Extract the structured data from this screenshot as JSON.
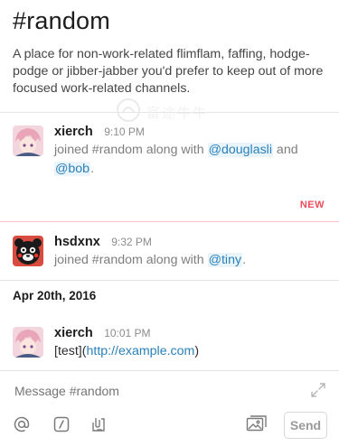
{
  "channel": {
    "title": "#random",
    "description": "A place for non-work-related flimflam, faffing, hodge-podge or jibber-jabber you'd prefer to keep out of more focused work-related channels."
  },
  "watermark": {
    "text": "富途牛牛"
  },
  "messages": [
    {
      "author": "xierch",
      "time": "9:10 PM",
      "text_parts": [
        "joined #random along with ",
        "@douglasli",
        " and ",
        "@bob",
        "."
      ]
    },
    {
      "author": "hsdxnx",
      "time": "9:32 PM",
      "text_parts": [
        "joined #random along with ",
        "@tiny",
        "."
      ]
    },
    {
      "author": "xierch",
      "time": "10:01 PM",
      "text_parts": [
        "[test](",
        "http://example.com",
        ")"
      ]
    }
  ],
  "new_marker": "NEW",
  "date_separator": "Apr 20th, 2016",
  "composer": {
    "placeholder": "Message #random",
    "send_label": "Send"
  },
  "icons": {
    "mention": "at-icon",
    "slash": "slash-command-icon",
    "upload": "file-upload-icon",
    "image": "image-icon",
    "expand": "expand-icon"
  },
  "colors": {
    "link": "#2a80b9",
    "new_marker": "#eb4d5c"
  }
}
